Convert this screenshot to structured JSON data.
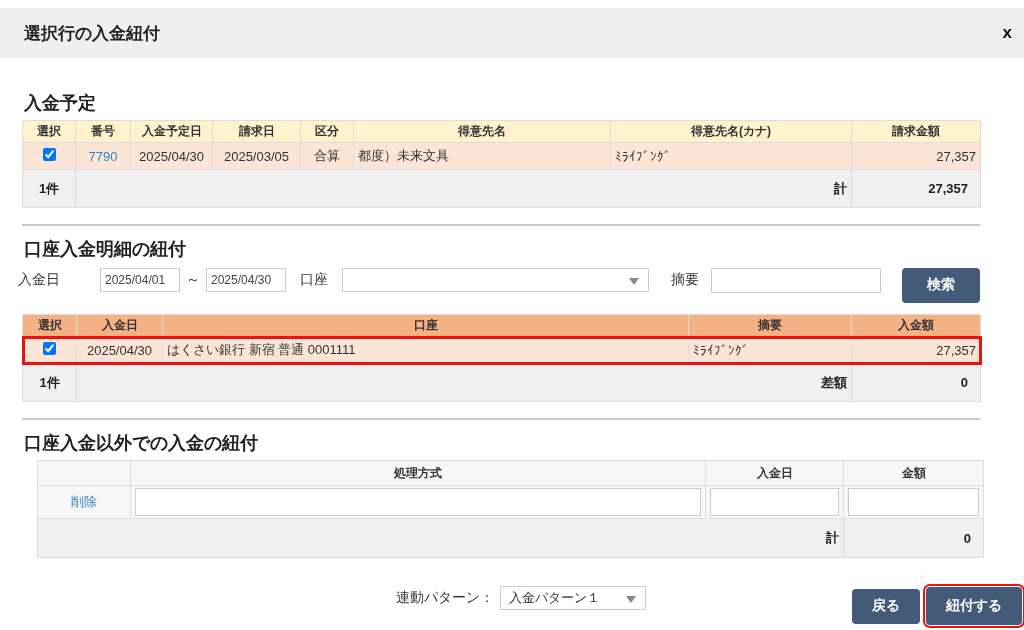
{
  "dialog": {
    "title": "選択行の入金紐付",
    "close": "x"
  },
  "schedule": {
    "heading": "入金予定",
    "columns": [
      "選択",
      "番号",
      "入金予定日",
      "請求日",
      "区分",
      "得意先名",
      "得意先名(カナ)",
      "請求金額"
    ],
    "rows": [
      {
        "selected": true,
        "cells": [
          {
            "kind": "checkbox"
          },
          {
            "kind": "link",
            "text": "7790"
          },
          {
            "kind": "center",
            "text": "2025/04/30"
          },
          {
            "kind": "center",
            "text": "2025/03/05"
          },
          {
            "kind": "center",
            "text": "合算"
          },
          {
            "kind": "text",
            "text": "都度）未来文具"
          },
          {
            "kind": "text",
            "text": "ﾐﾗｲﾌﾞﾝｸﾞ"
          },
          {
            "kind": "number",
            "text": "27,357"
          }
        ]
      }
    ],
    "footer": {
      "count": "1件",
      "total_label": "計",
      "total": "27,357"
    }
  },
  "bank": {
    "heading": "口座入金明細の紐付",
    "filters": {
      "date_label": "入金日",
      "date_from": "2025/04/01",
      "tilde": "～",
      "date_to": "2025/04/30",
      "account_label": "口座",
      "memo_label": "摘要"
    },
    "search_button": "検索",
    "columns": [
      "選択",
      "入金日",
      "口座",
      "摘要",
      "入金額"
    ],
    "rows": [
      {
        "selected": true,
        "highlighted": true,
        "cells": [
          {
            "kind": "checkbox"
          },
          {
            "kind": "center",
            "text": "2025/04/30"
          },
          {
            "kind": "text",
            "text": "はくさい銀行 新宿 普通 0001111"
          },
          {
            "kind": "text",
            "text": "ﾐﾗｲﾌﾞﾝｸﾞ"
          },
          {
            "kind": "number",
            "text": "27,357"
          }
        ]
      }
    ],
    "footer": {
      "count": "1件",
      "diff_label": "差額",
      "diff": "0"
    }
  },
  "other": {
    "heading": "口座入金以外での入金の紐付",
    "columns": [
      "処理方式",
      "入金日",
      "金額"
    ],
    "rows": [
      {
        "delete_link": "削除"
      }
    ],
    "footer": {
      "total_label": "計",
      "total": "0"
    }
  },
  "footer": {
    "pattern_label": "連動パターン：",
    "pattern_value": "入金パターン１",
    "buttons": [
      {
        "label": "戻る",
        "highlighted": false
      },
      {
        "label": "紐付する",
        "highlighted": true
      }
    ]
  }
}
